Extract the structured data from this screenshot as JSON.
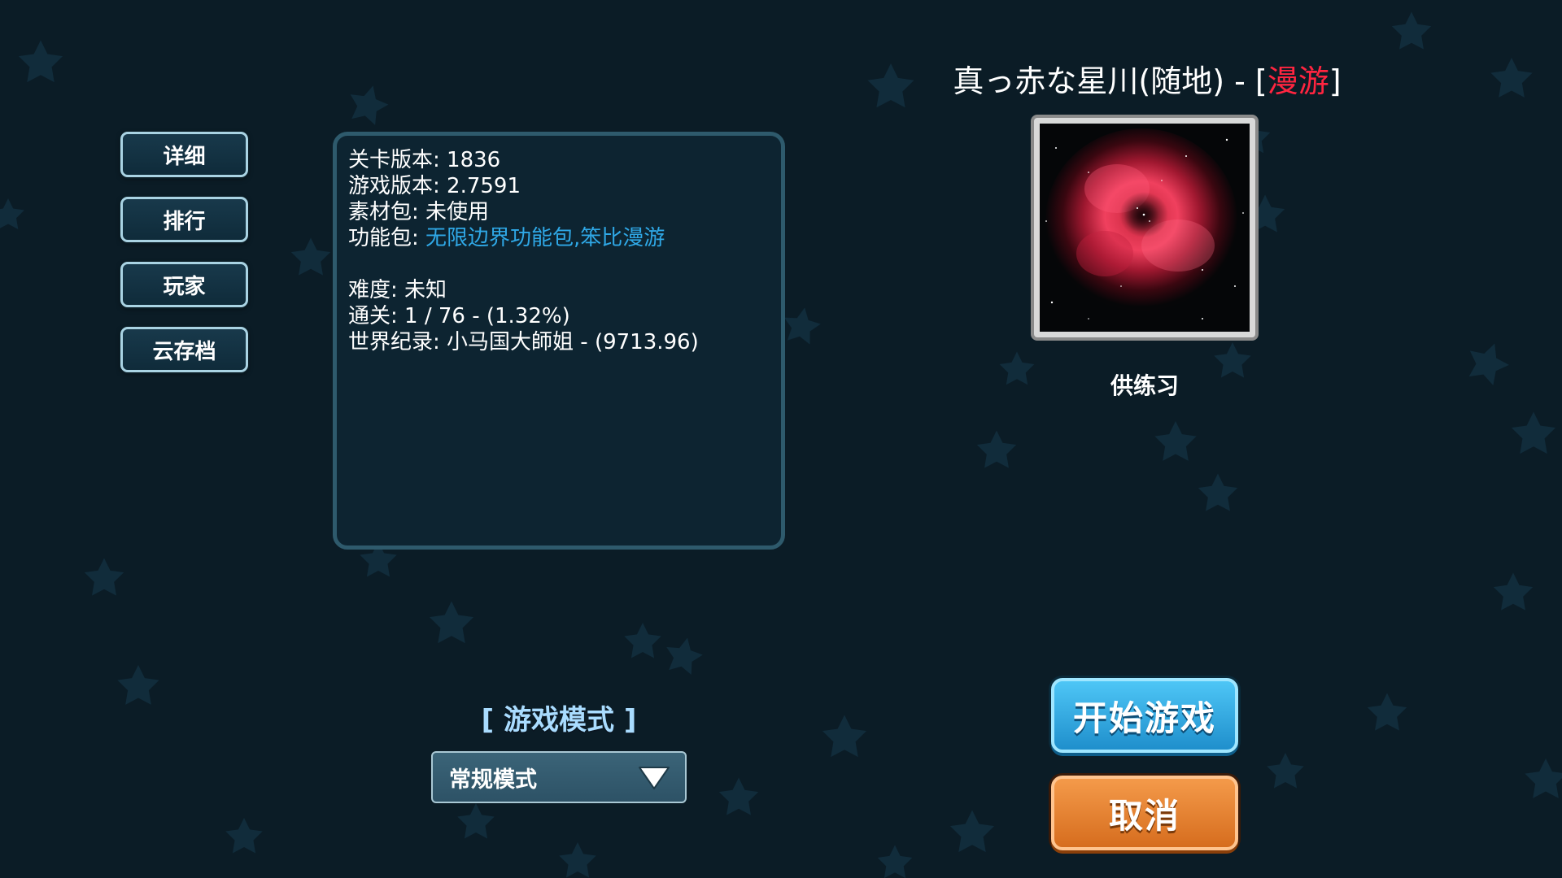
{
  "side_menu": {
    "items": [
      "详细",
      "排行",
      "玩家",
      "云存档"
    ]
  },
  "info": {
    "level_version_label": "关卡版本: ",
    "level_version": "1836",
    "game_version_label": "游戏版本: ",
    "game_version": "2.7591",
    "asset_pack_label": "素材包: ",
    "asset_pack": "未使用",
    "feature_pack_label": "功能包: ",
    "feature_pack": "无限边界功能包,笨比漫游",
    "difficulty_label": "难度: ",
    "difficulty": "未知",
    "clear_label": "通关: ",
    "clear": "1 / 76 - (1.32%)",
    "record_label": "世界纪录: ",
    "record": "小马国大師姐 - (9713.96)"
  },
  "level": {
    "title": "真っ赤な星川(随地) - [",
    "mode_tag": "漫游",
    "title_suffix": "]",
    "practice_label": "供练习"
  },
  "mode_section": {
    "title": "[ 游戏模式 ]",
    "selected": "常规模式"
  },
  "actions": {
    "start_label": "开始游戏",
    "cancel_label": "取消"
  },
  "colors": {
    "background": "#0b1c26",
    "mode_tag": "#ff2540",
    "link": "#2fa8e6",
    "start": "#2fa8e6",
    "cancel": "#e07a28"
  },
  "icons": {
    "dropdown": "triangle-down-icon",
    "background": "star-pattern",
    "preview": "red-nebula-image"
  }
}
